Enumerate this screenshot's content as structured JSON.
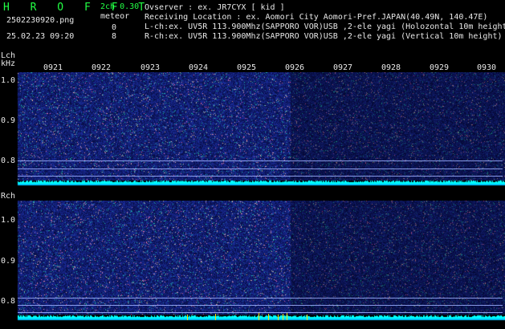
{
  "header": {
    "app_title": "H R O F F T",
    "mode": "2ch 0.30",
    "meteor_label": "meteor",
    "filename": "2502230920.png",
    "datetime": "25.02.23 09:20",
    "count_l": "0",
    "count_r": "8",
    "observer_line": "Ovserver           : ex. JR7CYX [ kid ]",
    "location_line": "Receiving Location : ex. Aomori City Aomori-Pref.JAPAN(40.49N, 140.47E)",
    "lch_line": "L-ch:ex. UV5R 113.900Mhz(SAPPORO VOR)USB ,2-ele yagi (Holozontal 10m height)",
    "rch_line": "R-ch:ex. UV5R 113.900Mhz(SAPPORO VOR)USB ,2-ele yagi (Vertical 10m height)"
  },
  "time_axis": {
    "labels": [
      "0921",
      "0922",
      "0923",
      "0924",
      "0925",
      "0926",
      "0927",
      "0928",
      "0929",
      "0930"
    ]
  },
  "lch": {
    "name": "Lch",
    "unit": "kHz",
    "y_ticks": [
      "1.0",
      "0.9",
      "0.8"
    ]
  },
  "rch": {
    "name": "Rch",
    "y_ticks": [
      "1.0",
      "0.9",
      "0.8"
    ]
  },
  "colors": {
    "background": "#000000",
    "title": "#22ff44",
    "text": "#e8e8e8",
    "noise": "#1a2a9a",
    "baseline": "#00ffff",
    "marker": "#ffdd00"
  }
}
